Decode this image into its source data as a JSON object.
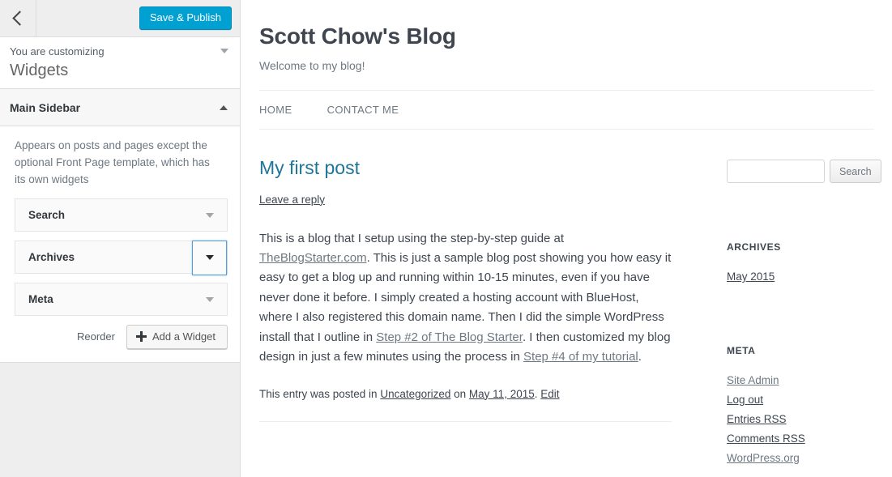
{
  "customizer": {
    "back_icon": "chevron-left-icon",
    "save_label": "Save & Publish",
    "customizing_label": "You are customizing",
    "panel_title": "Widgets",
    "section": {
      "title": "Main Sidebar",
      "collapse_icon": "caret-up-icon",
      "description": "Appears on posts and pages except the optional Front Page template, which has its own widgets",
      "widgets": [
        {
          "title": "Search",
          "toggle_icon": "caret-down-icon",
          "focused": false
        },
        {
          "title": "Archives",
          "toggle_icon": "caret-down-icon",
          "focused": true
        },
        {
          "title": "Meta",
          "toggle_icon": "caret-down-icon",
          "focused": false
        }
      ],
      "reorder_label": "Reorder",
      "add_widget_label": "Add a Widget",
      "add_widget_icon": "plus-icon"
    },
    "accent_color": "#00a0d2",
    "focus_color": "#5b9dd9"
  },
  "preview": {
    "site_title": "Scott Chow's Blog",
    "site_description": "Welcome to my blog!",
    "nav": [
      {
        "label": "HOME"
      },
      {
        "label": "CONTACT ME"
      }
    ],
    "post": {
      "title": "My first post",
      "title_color": "#21759b",
      "reply_link": "Leave a reply",
      "body": {
        "p1_a": "This is a blog that I setup using the step-by-step guide at ",
        "p1_link1": "TheBlogStarter.com",
        "p1_b": ". This is just a sample blog post showing you how easy it easy to get a blog up and running within 10-15 minutes, even if you have never done it before. I simply created a hosting account with BlueHost, where I also registered this domain name.  Then I did the simple WordPress install that I outline in ",
        "p1_link2": "Step #2 of The Blog Starter",
        "p1_c": ".  I then customized my blog design in just a few minutes using the process in ",
        "p1_link3": "Step #4 of my tutorial",
        "p1_d": "."
      },
      "footer": {
        "prefix": "This entry was posted in ",
        "category": "Uncategorized",
        "middle": " on ",
        "date": "May 11, 2015",
        "suffix": ". ",
        "edit": "Edit"
      }
    },
    "sidebar": {
      "search": {
        "value": "",
        "placeholder": "",
        "button_label": "Search"
      },
      "archives": {
        "heading": "ARCHIVES",
        "items": [
          {
            "label": "May 2015"
          }
        ]
      },
      "meta": {
        "heading": "META",
        "items": [
          {
            "label": "Site Admin"
          },
          {
            "label": "Log out"
          },
          {
            "label": "Entries RSS"
          },
          {
            "label": "Comments RSS"
          },
          {
            "label": "WordPress.org"
          }
        ]
      }
    }
  }
}
